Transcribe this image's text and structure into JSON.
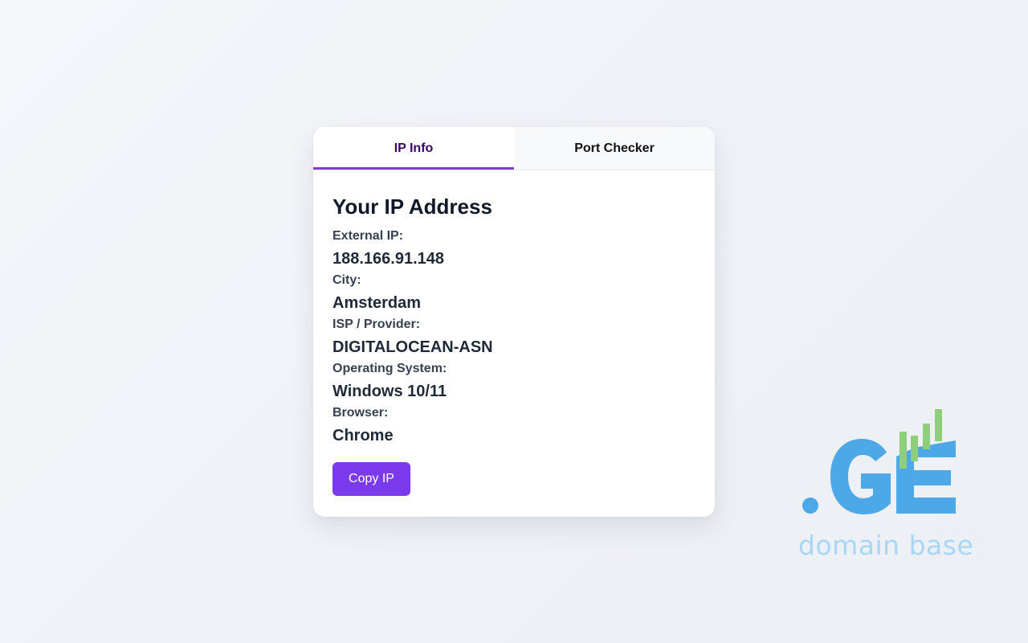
{
  "tabs": [
    {
      "label": "IP Info",
      "active": true
    },
    {
      "label": "Port Checker",
      "active": false
    }
  ],
  "ip_info": {
    "heading": "Your IP Address",
    "fields": [
      {
        "label": "External IP:",
        "value": "188.166.91.148"
      },
      {
        "label": "City:",
        "value": "Amsterdam"
      },
      {
        "label": "ISP / Provider:",
        "value": "DIGITALOCEAN-ASN"
      },
      {
        "label": "Operating System:",
        "value": "Windows 10/11"
      },
      {
        "label": "Browser:",
        "value": "Chrome"
      }
    ],
    "copy_button": "Copy IP"
  },
  "logo": {
    "mark": ".GE",
    "tagline": "domain base",
    "icon": "signal-bars-icon",
    "colors": {
      "primary": "#4da8e8",
      "bars": "#8fce7a",
      "tagline": "#a9d6f5"
    }
  },
  "colors": {
    "accent": "#7c3aed",
    "active_tab_text": "#3b0764",
    "active_tab_underline": "#7e3fd1"
  }
}
